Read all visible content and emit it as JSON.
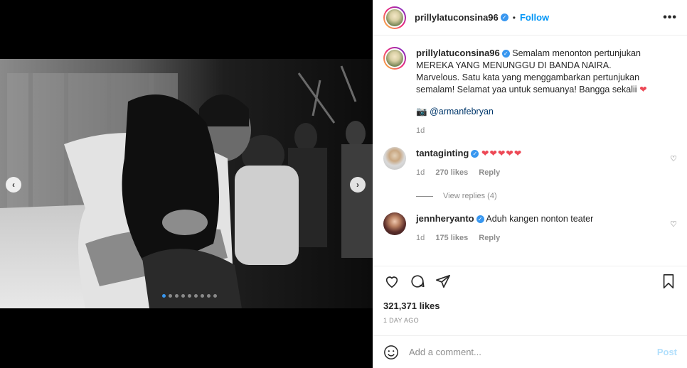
{
  "post": {
    "username": "prillylatuconsina96",
    "follow_label": "Follow",
    "bullet": "•",
    "more_label": "•••",
    "caption": {
      "line1": "Semalam menonton pertunjukan MEREKA YANG MENUNGGU DI BANDA NAIRA.",
      "line2": "Marvelous. Satu kata yang menggambarkan pertunjukan semalam! Selamat yaa untuk semuanya! Bangga sekalii",
      "heart": "❤",
      "credit_icon": "📷",
      "credit": "@armanfebryan",
      "time": "1d"
    },
    "likes": "321,371 likes",
    "posted": "1 DAY AGO"
  },
  "comments": [
    {
      "username": "tantaginting",
      "text": "❤❤❤❤❤",
      "time": "1d",
      "likes": "270 likes",
      "reply": "Reply"
    },
    {
      "username": "jennheryanto",
      "text": "Aduh kangen nonton teater",
      "time": "1d",
      "likes": "175 likes",
      "reply": "Reply"
    }
  ],
  "view_replies": "View replies (4)",
  "add_comment": {
    "placeholder": "Add a comment...",
    "post_label": "Post"
  },
  "carousel": {
    "dot_count": 9,
    "active_index": 0
  },
  "icons": {
    "verified": "verified-badge",
    "like": "heart-outline-icon",
    "comment": "comment-bubble-icon",
    "share": "paper-plane-icon",
    "save": "bookmark-icon",
    "emoji": "smiley-icon"
  },
  "colors": {
    "accent_blue": "#0095f6",
    "heart_red": "#ed4956",
    "muted": "#8e8e8e",
    "post_disabled": "#b2dffc"
  }
}
